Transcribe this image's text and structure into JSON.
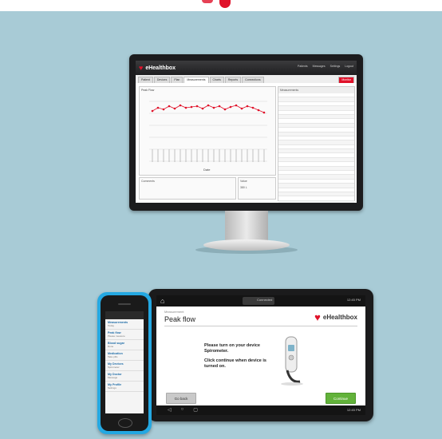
{
  "monitor": {
    "app_title": "eHealthbox",
    "header_links": [
      "Patients",
      "Messages",
      "Settings",
      "Logout"
    ],
    "tabs": [
      "Patient",
      "Devices",
      "Plan",
      "Measurements",
      "Charts",
      "Reports",
      "Connections",
      "Monitor"
    ],
    "chart_title": "Peak Flow",
    "chart_xlabel": "Date",
    "right_table_title": "Measurements",
    "bottom_box_label": "Comments",
    "bottom_box2_label": "Value",
    "bottom_box2_value": "380 L"
  },
  "tablet": {
    "status_center": "Connected",
    "status_right": "12:45 PM",
    "page_sub": "Measurement",
    "page_title": "Peak flow",
    "logo_text": "eHealthbox",
    "instruction_1": "Please turn on your device Spirometer.",
    "instruction_2": "Click continue when device is turned on.",
    "back_label": "Go back",
    "continue_label": "Continue",
    "nav_time": "12:45 PM"
  },
  "phone": {
    "items": [
      {
        "title": "Measurements",
        "sub": "Today"
      },
      {
        "title": "Peak flow",
        "sub": "Please measure"
      },
      {
        "title": "Blood sugar",
        "sub": "Done"
      },
      {
        "title": "Medication",
        "sub": "Take pills"
      },
      {
        "title": "My Devices",
        "sub": "Spirometer"
      },
      {
        "title": "My Doctor",
        "sub": "Message"
      },
      {
        "title": "My Profile",
        "sub": "Settings"
      }
    ]
  },
  "colors": {
    "accent": "#e0122a",
    "continue": "#62b23a",
    "background": "#a8cbd6",
    "phone_body": "#24a8e2"
  }
}
